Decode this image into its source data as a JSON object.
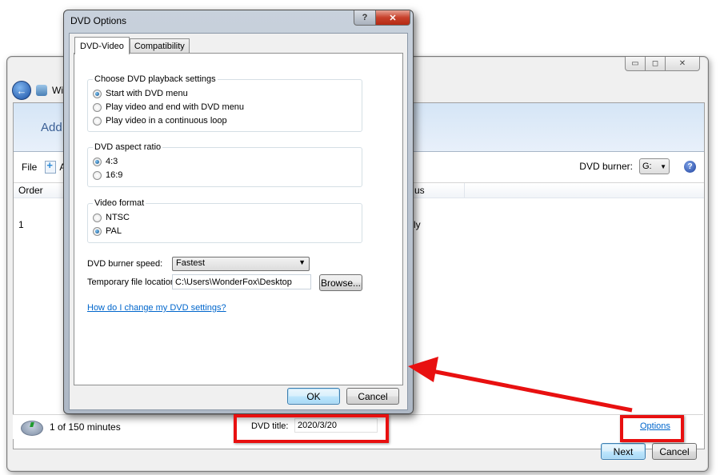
{
  "main_window": {
    "app_name_partial": "Wi",
    "banner_partial": "Add",
    "toolbar": {
      "file_label": "File",
      "add_partial": "A"
    },
    "burner": {
      "label": "DVD burner:",
      "value": "G:"
    },
    "list": {
      "columns": [
        "Order",
        "us"
      ],
      "rows": [
        {
          "order": "1",
          "status_partial": "ly"
        }
      ]
    },
    "status": {
      "minutes_text": "1 of 150 minutes",
      "dvd_title_label": "DVD title:",
      "dvd_title_value": "2020/3/20",
      "options_link": "Options"
    },
    "buttons": {
      "next": "Next",
      "cancel": "Cancel"
    },
    "window_controls": {
      "minimize": "▭",
      "maximize": "◻",
      "close": "✕"
    }
  },
  "dialog": {
    "title": "DVD Options",
    "help_glyph": "?",
    "close_glyph": "✕",
    "tabs": [
      {
        "label": "DVD-Video",
        "active": true
      },
      {
        "label": "Compatibility",
        "active": false
      }
    ],
    "playback": {
      "legend": "Choose DVD playback settings",
      "options": [
        {
          "label": "Start with DVD menu",
          "selected": true
        },
        {
          "label": "Play video and end with DVD menu",
          "selected": false
        },
        {
          "label": "Play video in a continuous loop",
          "selected": false
        }
      ]
    },
    "aspect": {
      "legend": "DVD aspect ratio",
      "options": [
        {
          "label": "4:3",
          "selected": true
        },
        {
          "label": "16:9",
          "selected": false
        }
      ]
    },
    "format": {
      "legend": "Video format",
      "options": [
        {
          "label": "NTSC",
          "selected": false
        },
        {
          "label": "PAL",
          "selected": true
        }
      ]
    },
    "burner_speed": {
      "label": "DVD burner speed:",
      "value": "Fastest"
    },
    "temp_location": {
      "label": "Temporary file location:",
      "value": "C:\\Users\\WonderFox\\Desktop",
      "browse_label": "Browse..."
    },
    "help_link": "How do I change my DVD settings?",
    "ok_label": "OK",
    "cancel_label": "Cancel"
  },
  "annotation": {
    "color": "#e81010"
  }
}
